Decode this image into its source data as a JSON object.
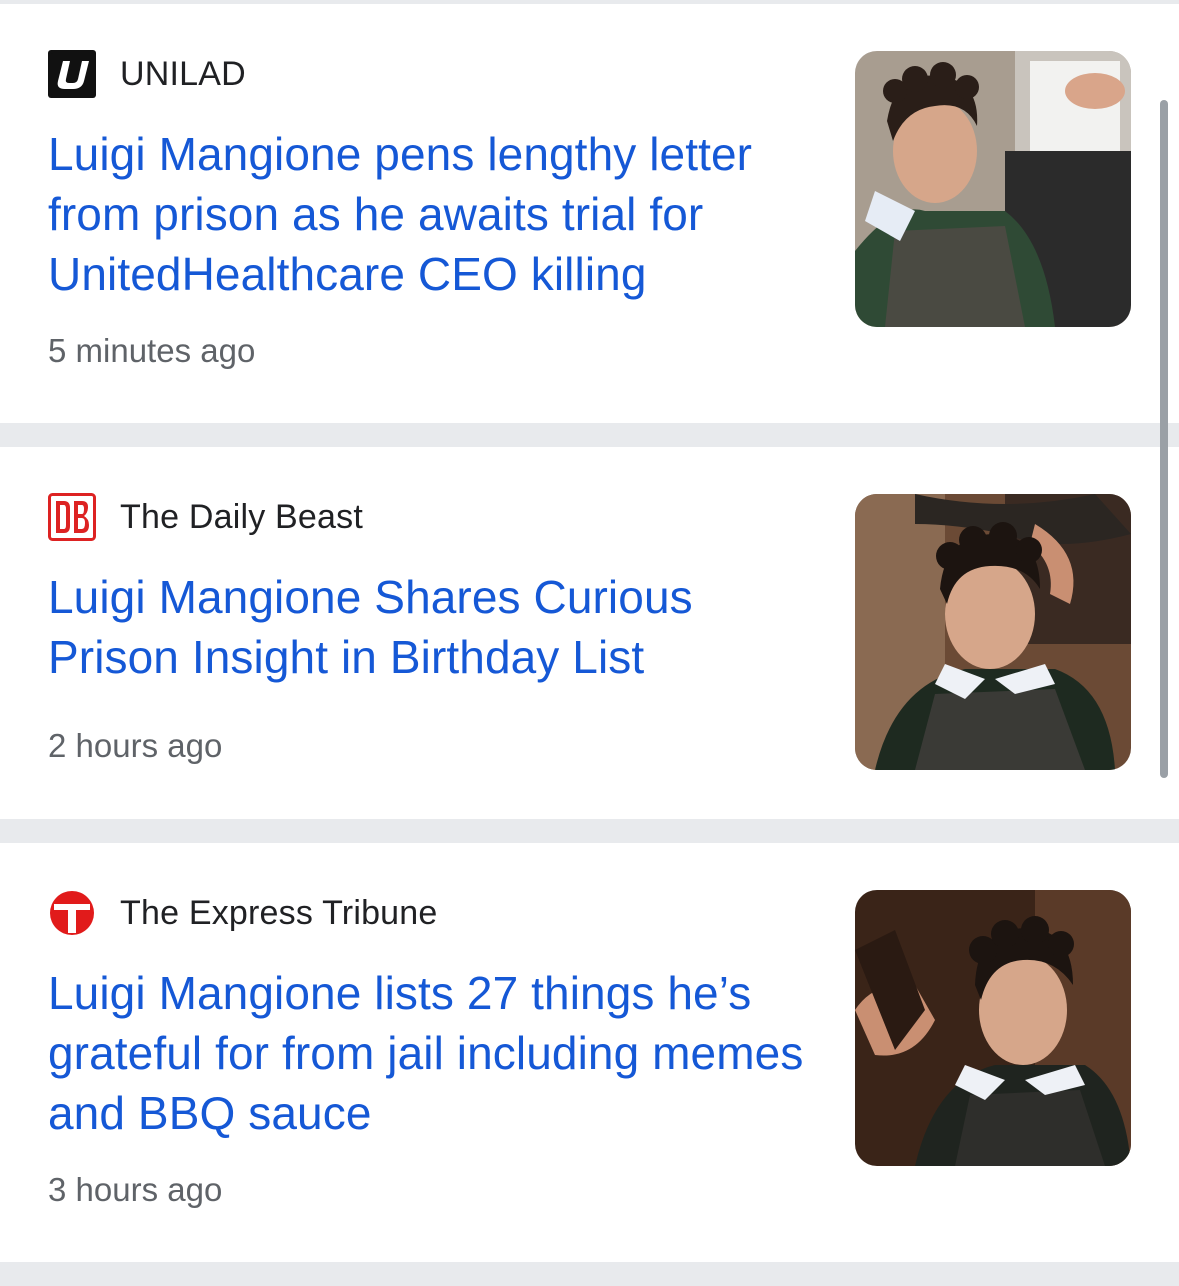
{
  "articles": [
    {
      "source": "UNILAD",
      "logo_text": "U",
      "headline": "Luigi Mangione pens lengthy letter from prison as he awaits trial for UnitedHealthcare CEO killing",
      "time": "5 minutes ago"
    },
    {
      "source": "The Daily Beast",
      "logo_text": "DB",
      "headline": "Luigi Mangione Shares Curious Prison Insight in Birthday List",
      "time": "2 hours ago"
    },
    {
      "source": "The Express Tribune",
      "logo_text": "T",
      "headline": "Luigi Mangione lists 27 things he’s grateful for from jail including memes and BBQ sauce",
      "time": "3 hours ago"
    }
  ],
  "colors": {
    "headline": "#1558d6",
    "source": "#202124",
    "time": "#5f6368",
    "separator": "#e8eaed",
    "daily_beast_red": "#d22",
    "tribune_red": "#e11b1b"
  }
}
